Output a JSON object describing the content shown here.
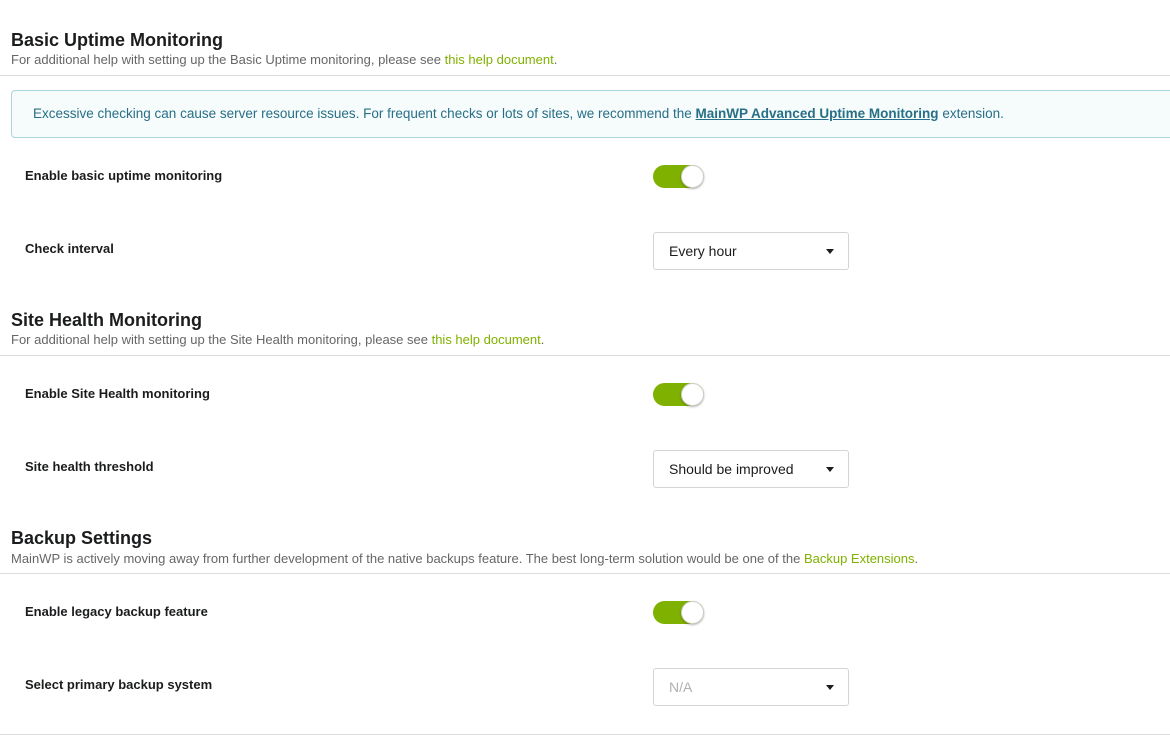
{
  "uptime": {
    "title": "Basic Uptime Monitoring",
    "desc_prefix": "For additional help with setting up the Basic Uptime monitoring, please see ",
    "desc_link": "this help document",
    "desc_suffix": ".",
    "notice_prefix": "Excessive checking can cause server resource issues. For frequent checks or lots of sites, we recommend the ",
    "notice_link": "MainWP Advanced Uptime Monitoring",
    "notice_suffix": " extension.",
    "enable_label": "Enable basic uptime monitoring",
    "enable_on": true,
    "interval_label": "Check interval",
    "interval_value": "Every hour"
  },
  "health": {
    "title": "Site Health Monitoring",
    "desc_prefix": "For additional help with setting up the Site Health monitoring, please see ",
    "desc_link": "this help document",
    "desc_suffix": ".",
    "enable_label": "Enable Site Health monitoring",
    "enable_on": true,
    "threshold_label": "Site health threshold",
    "threshold_value": "Should be improved"
  },
  "backup": {
    "title": "Backup Settings",
    "desc_prefix": "MainWP is actively moving away from further development of the native backups feature. The best long-term solution would be one of the ",
    "desc_link": "Backup Extensions",
    "desc_suffix": ".",
    "enable_label": "Enable legacy backup feature",
    "enable_on": true,
    "primary_label": "Select primary backup system",
    "primary_value": "N/A"
  },
  "colors": {
    "accent": "#7fb100",
    "notice_text": "#276f86",
    "notice_bg": "#f6fbfc"
  }
}
